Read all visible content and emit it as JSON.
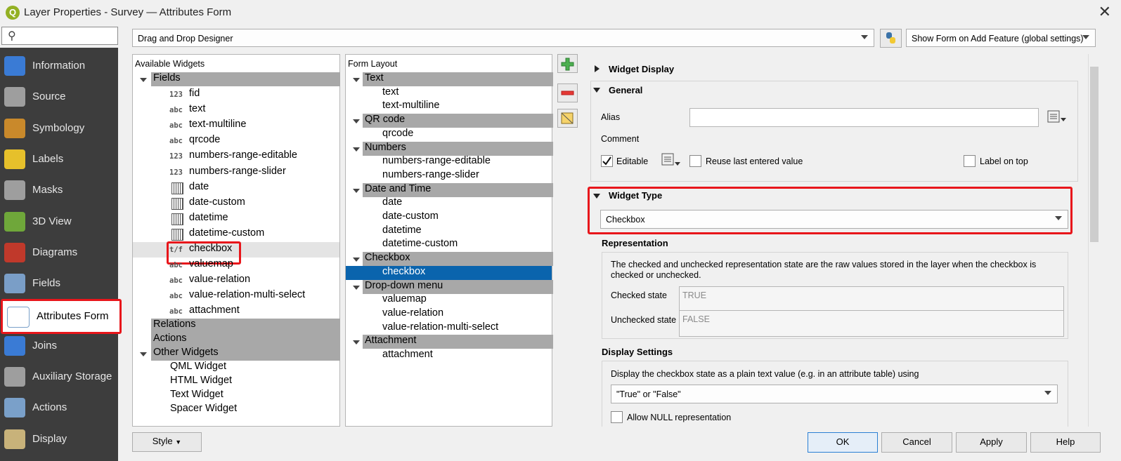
{
  "window": {
    "title": "Layer Properties - Survey — Attributes Form",
    "close_glyph": "✕"
  },
  "search": {
    "icon": "search-icon",
    "placeholder": ""
  },
  "sidebar": {
    "items": [
      {
        "label": "Information",
        "icon": "information-icon"
      },
      {
        "label": "Source",
        "icon": "source-icon"
      },
      {
        "label": "Symbology",
        "icon": "symbology-icon"
      },
      {
        "label": "Labels",
        "icon": "labels-icon"
      },
      {
        "label": "Masks",
        "icon": "masks-icon"
      },
      {
        "label": "3D View",
        "icon": "3d-view-icon"
      },
      {
        "label": "Diagrams",
        "icon": "diagrams-icon"
      },
      {
        "label": "Fields",
        "icon": "fields-icon"
      },
      {
        "label": "Attributes Form",
        "icon": "attributes-form-icon"
      },
      {
        "label": "Joins",
        "icon": "joins-icon"
      },
      {
        "label": "Auxiliary Storage",
        "icon": "auxiliary-storage-icon"
      },
      {
        "label": "Actions",
        "icon": "actions-icon"
      },
      {
        "label": "Display",
        "icon": "display-icon"
      }
    ],
    "selected": "Attributes Form"
  },
  "toolbar": {
    "designer_mode": "Drag and Drop Designer",
    "show_form": "Show Form on Add Feature (global settings)"
  },
  "available": {
    "header": "Available Widgets",
    "fields_group": "Fields",
    "fields": [
      {
        "type": "123",
        "name": "fid"
      },
      {
        "type": "abc",
        "name": "text"
      },
      {
        "type": "abc",
        "name": "text-multiline"
      },
      {
        "type": "abc",
        "name": "qrcode"
      },
      {
        "type": "123",
        "name": "numbers-range-editable"
      },
      {
        "type": "123",
        "name": "numbers-range-slider"
      },
      {
        "type": "date",
        "name": "date"
      },
      {
        "type": "date",
        "name": "date-custom"
      },
      {
        "type": "datetime",
        "name": "datetime"
      },
      {
        "type": "datetime",
        "name": "datetime-custom"
      },
      {
        "type": "t/f",
        "name": "checkbox"
      },
      {
        "type": "abc",
        "name": "valuemap"
      },
      {
        "type": "abc",
        "name": "value-relation"
      },
      {
        "type": "abc",
        "name": "value-relation-multi-select"
      },
      {
        "type": "abc",
        "name": "attachment"
      }
    ],
    "relations": "Relations",
    "actions": "Actions",
    "other_group": "Other Widgets",
    "other": [
      "QML Widget",
      "HTML Widget",
      "Text Widget",
      "Spacer Widget"
    ]
  },
  "layout": {
    "header": "Form Layout",
    "groups": [
      {
        "name": "Text",
        "items": [
          "text",
          "text-multiline"
        ]
      },
      {
        "name": "QR code",
        "items": [
          "qrcode"
        ]
      },
      {
        "name": "Numbers",
        "items": [
          "numbers-range-editable",
          "numbers-range-slider"
        ]
      },
      {
        "name": "Date and Time",
        "items": [
          "date",
          "date-custom",
          "datetime",
          "datetime-custom"
        ]
      },
      {
        "name": "Checkbox",
        "items": [
          "checkbox"
        ]
      },
      {
        "name": "Drop-down menu",
        "items": [
          "valuemap",
          "value-relation",
          "value-relation-multi-select"
        ]
      },
      {
        "name": "Attachment",
        "items": [
          "attachment"
        ]
      }
    ],
    "selected": "checkbox"
  },
  "props": {
    "widget_display": "Widget Display",
    "general": "General",
    "alias_label": "Alias",
    "alias_value": "",
    "comment_label": "Comment",
    "editable_label": "Editable",
    "editable_checked": true,
    "reuse_label": "Reuse last entered value",
    "label_on_top": "Label on top",
    "widget_type_header": "Widget Type",
    "widget_type_value": "Checkbox",
    "representation": "Representation",
    "repr_text": "The checked and unchecked representation state are the raw values stored in the layer when the checkbox is checked or unchecked.",
    "checked_label": "Checked state",
    "checked_value": "TRUE",
    "unchecked_label": "Unchecked state",
    "unchecked_value": "FALSE",
    "display_settings": "Display Settings",
    "display_text": "Display the checkbox state as a plain text value (e.g. in an attribute table) using",
    "display_value": "\"True\" or \"False\"",
    "allow_null": "Allow NULL representation"
  },
  "buttons": {
    "style": "Style",
    "ok": "OK",
    "cancel": "Cancel",
    "apply": "Apply",
    "help": "Help"
  },
  "colors": {
    "highlight": "#e8161b",
    "selection": "#0a64ad",
    "sidebar": "#3d3d3d"
  }
}
